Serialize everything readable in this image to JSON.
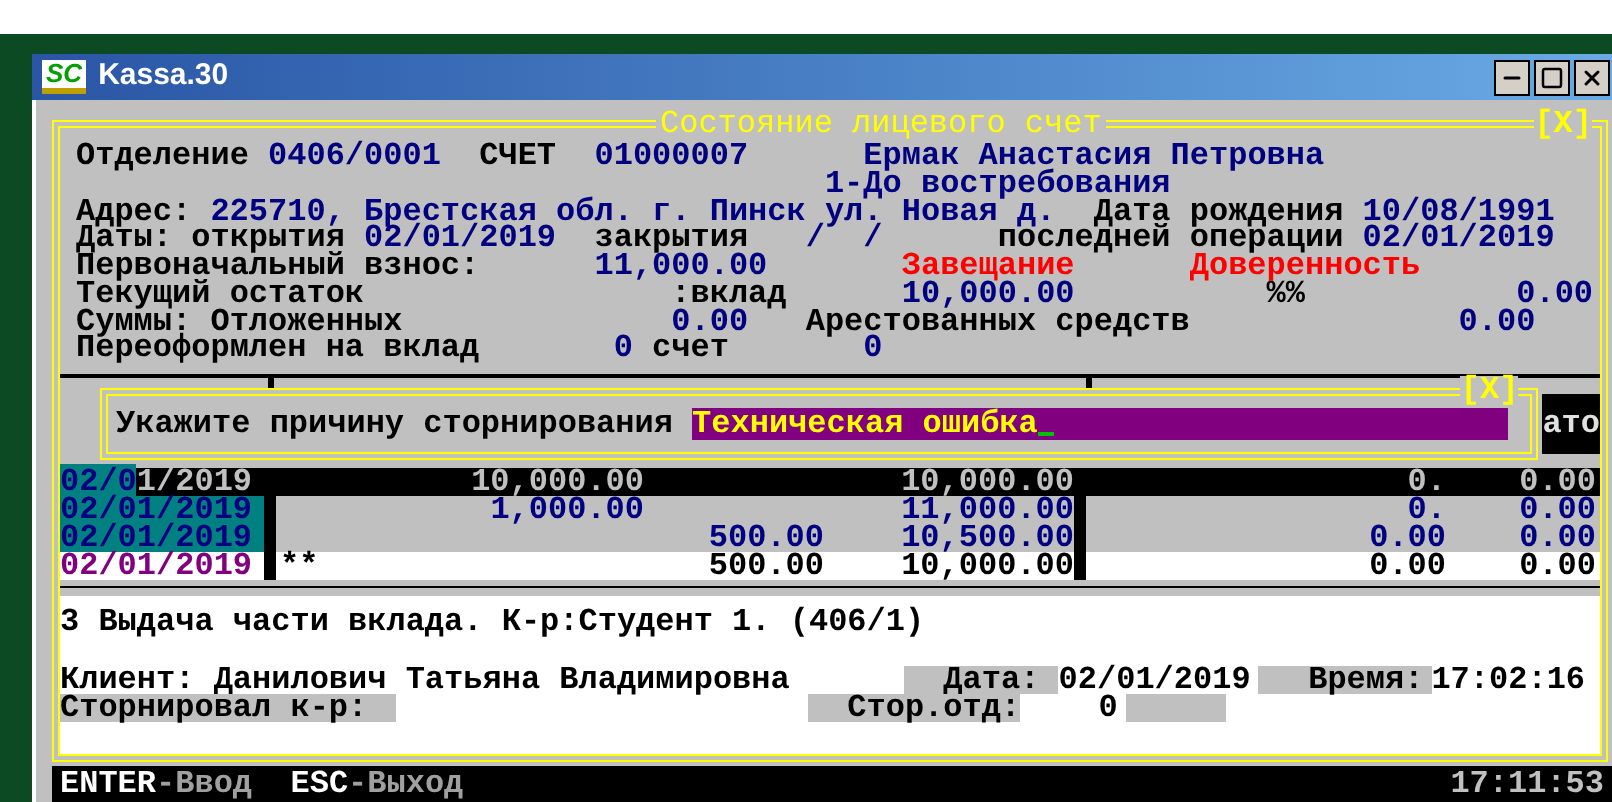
{
  "window": {
    "logo": "SC",
    "title": "Kassa.30"
  },
  "panel": {
    "title": "Состояние лицевого счет",
    "close": "[X]",
    "lines": [
      [
        {
          "text": "Отделение",
          "kind": "label"
        },
        {
          "text": "0406/0001",
          "kind": "value"
        },
        {
          "text": "СЧЕТ",
          "kind": "label"
        },
        {
          "text": "01000007",
          "kind": "value"
        },
        {
          "text": "Ермак Анастасия Петровна",
          "kind": "value"
        }
      ],
      [
        {
          "text": "1-До востребования",
          "kind": "value"
        }
      ],
      [
        {
          "text": "Адрес:",
          "kind": "label"
        },
        {
          "text": "225710, Брестская обл. г. Пинск ул. Новая д.",
          "kind": "value"
        },
        {
          "text": "Дата рождения",
          "kind": "label"
        },
        {
          "text": "10/08/1991",
          "kind": "value"
        }
      ],
      [
        {
          "text": "Даты: открытия",
          "kind": "label"
        },
        {
          "text": "02/01/2019",
          "kind": "value"
        },
        {
          "text": "закрытия",
          "kind": "label"
        },
        {
          "text": "/  /",
          "kind": "value"
        },
        {
          "text": "последней операции",
          "kind": "label"
        },
        {
          "text": "02/01/2019",
          "kind": "value"
        }
      ],
      [
        {
          "text": "Первоначальный взнос:",
          "kind": "label"
        },
        {
          "text": "11,000.00",
          "kind": "value"
        },
        {
          "text": "Завещание",
          "kind": "alert"
        },
        {
          "text": "Доверенность",
          "kind": "alert"
        }
      ],
      [
        {
          "text": "Текущий остаток",
          "kind": "label"
        },
        {
          "text": ":вклад",
          "kind": "label"
        },
        {
          "text": "10,000.00",
          "kind": "value"
        },
        {
          "text": "%%",
          "kind": "label"
        },
        {
          "text": "0.00",
          "kind": "value"
        }
      ],
      [
        {
          "text": "Суммы: Отложенных",
          "kind": "label"
        },
        {
          "text": "0.00",
          "kind": "value"
        },
        {
          "text": "Арестованных средств",
          "kind": "label"
        },
        {
          "text": "0.00",
          "kind": "value"
        }
      ],
      [
        {
          "text": "Переоформлен на вклад",
          "kind": "label"
        },
        {
          "text": "0",
          "kind": "value"
        },
        {
          "text": "счет",
          "kind": "label"
        },
        {
          "text": "0",
          "kind": "value"
        }
      ]
    ]
  },
  "dialog": {
    "close": "[X]",
    "prompt": "Укажите причину сторнирования",
    "value": "Техническая ошибка",
    "obscured_text": "ато"
  },
  "operations": [
    {
      "date": "02/01/2019",
      "column_2": "10,000.00",
      "column_4": "10,000.00",
      "column_5": "0.",
      "column_6": "0.00",
      "selected": true,
      "kind": "entry"
    },
    {
      "date": "02/01/2019",
      "column_2": "1,000.00",
      "column_4": "11,000.00",
      "column_5": "0.",
      "column_6": "0.00",
      "selected": false,
      "kind": "entry"
    },
    {
      "date": "02/01/2019",
      "column_3": "500.00",
      "column_4": "10,500.00",
      "column_5": "0.00",
      "column_6": "0.00",
      "selected": false,
      "kind": "entry"
    },
    {
      "date": "02/01/2019",
      "mark": "**",
      "column_3": "500.00",
      "column_4": "10,000.00",
      "column_5": "0.00",
      "column_6": "0.00",
      "selected": false,
      "kind": "marked"
    }
  ],
  "details": {
    "message": "3 Выдача части вклада. К-р:Студент 1. (406/1)",
    "client_label": "Клиент:",
    "client": "Данилович Татьяна Владимировна",
    "date_label": "Дата:",
    "date": "02/01/2019",
    "time_label": "Время:",
    "time": "17:02:16",
    "reversed_by_label": "Сторнировал к-р:",
    "reversal_branch_label": "Стор.отд:",
    "reversal_branch": "0"
  },
  "status_bar": {
    "keys": [
      {
        "key": "ENTER",
        "action": "-Ввод"
      },
      {
        "key": "ESC",
        "action": "-Выход"
      }
    ],
    "time": "17:11:53"
  }
}
